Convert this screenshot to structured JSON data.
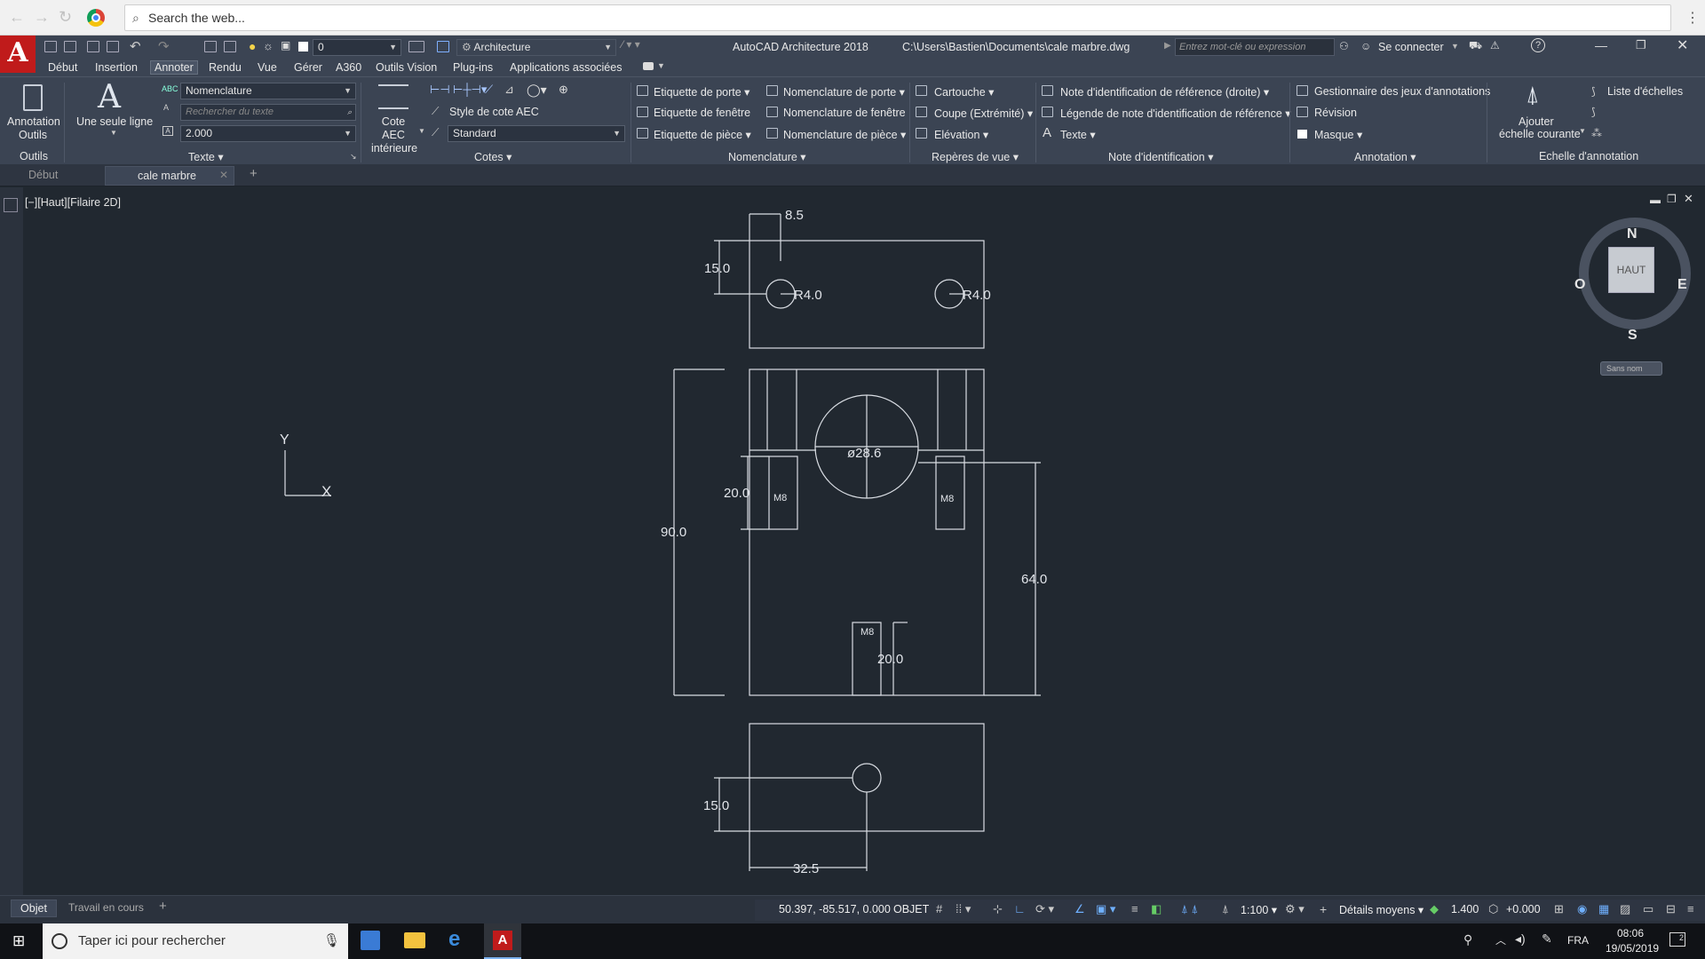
{
  "browser": {
    "search_placeholder": "Search the web..."
  },
  "app": {
    "title": "AutoCAD Architecture 2018",
    "file_path": "C:\\Users\\Bastien\\Documents\\cale marbre.dwg",
    "workspace": "Architecture",
    "layer_value": "0",
    "search_placeholder": "Entrez mot-clé ou expression",
    "sign_in": "Se connecter"
  },
  "menu": [
    "Début",
    "Insertion",
    "Annoter",
    "Rendu",
    "Vue",
    "Gérer",
    "A360",
    "Outils Vision",
    "Plug-ins",
    "Applications associées"
  ],
  "ribbon": {
    "outils": {
      "tool": "Annotation\nOutils",
      "panel": "Outils"
    },
    "texte": {
      "single_line": "Une seule ligne",
      "style": "Nomenclature",
      "search_placeholder": "Rechercher du texte",
      "height": "2.000",
      "panel": "Texte"
    },
    "cotes": {
      "aec": "Cote AEC intérieure",
      "style_label": "Style de cote AEC",
      "style_value": "Standard",
      "panel": "Cotes"
    },
    "etiquettes": [
      "Etiquette de porte",
      "Etiquette de fenêtre",
      "Etiquette de pièce"
    ],
    "nomenclatures": [
      "Nomenclature de porte",
      "Nomenclature de fenêtre",
      "Nomenclature de pièce"
    ],
    "nomenclature_panel": "Nomenclature",
    "reperes": [
      "Cartouche",
      "Coupe (Extrémité)",
      "Elévation"
    ],
    "reperes_panel": "Repères de vue",
    "notes": [
      "Note d'identification de référence (droite)",
      "Légende de note d'identification de référence",
      "Texte"
    ],
    "notes_panel": "Note d'identification",
    "annotation": [
      "Gestionnaire des jeux d'annotations",
      "Révision",
      "Masque"
    ],
    "annotation_panel": "Annotation",
    "echelle": {
      "add": "Ajouter",
      "add2": "échelle courante",
      "list": "Liste d'échelles",
      "panel": "Echelle d'annotation"
    }
  },
  "doc_tabs": [
    "Début",
    "cale marbre"
  ],
  "viewport": {
    "label": "[−][Haut][Filaire 2D]"
  },
  "viewcube": {
    "n": "N",
    "s": "S",
    "e": "E",
    "w": "O",
    "face": "HAUT",
    "ucs": "Sans nom"
  },
  "drawing": {
    "dims": {
      "d85": "8.5",
      "d15a": "15.0",
      "r1": "R4.0",
      "r2": "R4.0",
      "dia": "ø28.6",
      "d20a": "20.0",
      "m8a": "M8",
      "m8b": "M8",
      "m8c": "M8",
      "d90": "90.0",
      "d64": "64.0",
      "d20b": "20.0",
      "d15b": "15.0",
      "d325": "32.5"
    },
    "ucs_x": "X",
    "ucs_y": "Y"
  },
  "layout_tabs": [
    "Objet",
    "Travail en cours"
  ],
  "status": {
    "coords": "50.397, -85.517, 0.000",
    "mode": "OBJET",
    "scale": "1:100",
    "detail": "Détails moyens",
    "cut_plane": "1.400",
    "elevation": "+0.000"
  },
  "taskbar": {
    "search": "Taper ici pour rechercher",
    "lang": "FRA",
    "time": "08:06",
    "date": "19/05/2019",
    "notif": "2"
  }
}
